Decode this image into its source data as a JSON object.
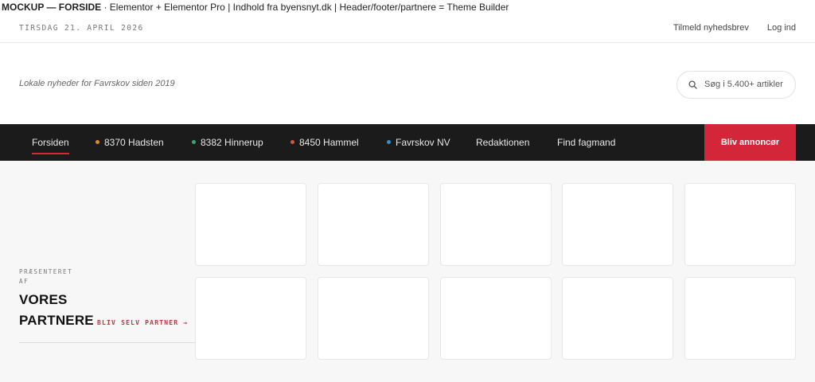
{
  "banner": {
    "strong": "MOCKUP — FORSIDE",
    "rest": " · Elementor + Elementor Pro | Indhold fra byensnyt.dk | Header/footer/partnere = Theme Builder"
  },
  "topbar": {
    "date": "TIRSDAG 21. APRIL 2026",
    "newsletter": "Tilmeld nyhedsbrev",
    "login": "Log ind"
  },
  "brand": {
    "tagline": "Lokale nyheder for Favrskov siden 2019"
  },
  "search": {
    "placeholder": "Søg i 5.400+ artikler",
    "icon": "search-icon"
  },
  "nav": {
    "items": [
      {
        "label": "Forsiden",
        "active": true
      },
      {
        "label": "8370 Hadsten",
        "dot": "#e08a2c"
      },
      {
        "label": "8382 Hinnerup",
        "dot": "#3aa86b"
      },
      {
        "label": "8450 Hammel",
        "dot": "#d6543a"
      },
      {
        "label": "Favrskov NV",
        "dot": "#3b8fc9"
      },
      {
        "label": "Redaktionen"
      },
      {
        "label": "Find fagmand"
      }
    ],
    "cta": "Bliv annoncør"
  },
  "partners": {
    "eyebrow": "PRÆSENTERET AF",
    "title_line1": "VORES",
    "title_line2": "PARTNERE",
    "become": "BLIV SELV PARTNER →",
    "logo_count": 10
  },
  "colors": {
    "accent": "#d42639",
    "nav_bg": "#1b1b1b",
    "section_bg": "#f7f7f7"
  }
}
